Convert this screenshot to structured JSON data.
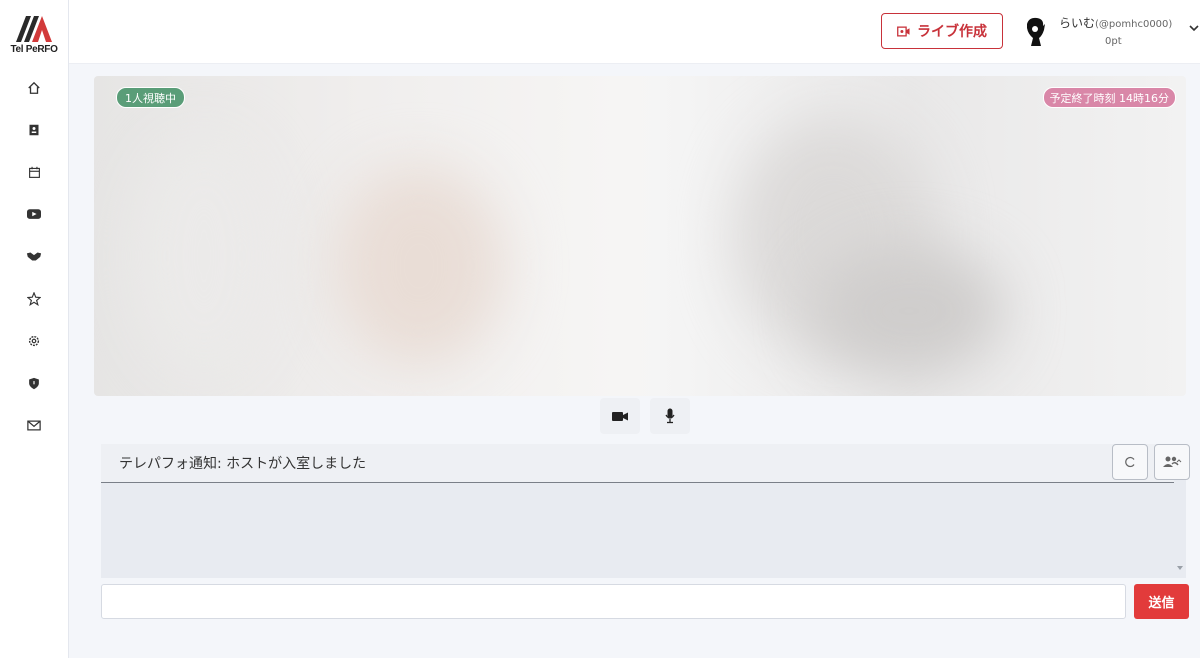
{
  "app": {
    "logo_text": "Tel PeRFO"
  },
  "sidebar": {
    "items": [
      {
        "icon": "home-icon"
      },
      {
        "icon": "id-card-icon"
      },
      {
        "icon": "calendar-icon"
      },
      {
        "icon": "video-icon"
      },
      {
        "icon": "handshake-icon"
      },
      {
        "icon": "star-icon"
      },
      {
        "icon": "gear-icon"
      },
      {
        "icon": "shield-icon"
      },
      {
        "icon": "mail-icon"
      }
    ]
  },
  "header": {
    "create_live_label": "ライブ作成",
    "user_name": "らいむ",
    "user_handle": "(@pomhc0000)",
    "user_points": "0pt"
  },
  "video": {
    "viewers_badge": "1人視聴中",
    "end_time_badge": "予定終了時刻 14時16分"
  },
  "chat": {
    "notice": "テレパフォ通知: ホストが入室しました",
    "input_value": "",
    "send_label": "送信"
  },
  "colors": {
    "accent": "#c8323a",
    "send": "#e23b3b",
    "viewers_badge": "#5a9d78",
    "end_time_badge": "#d987a8"
  }
}
